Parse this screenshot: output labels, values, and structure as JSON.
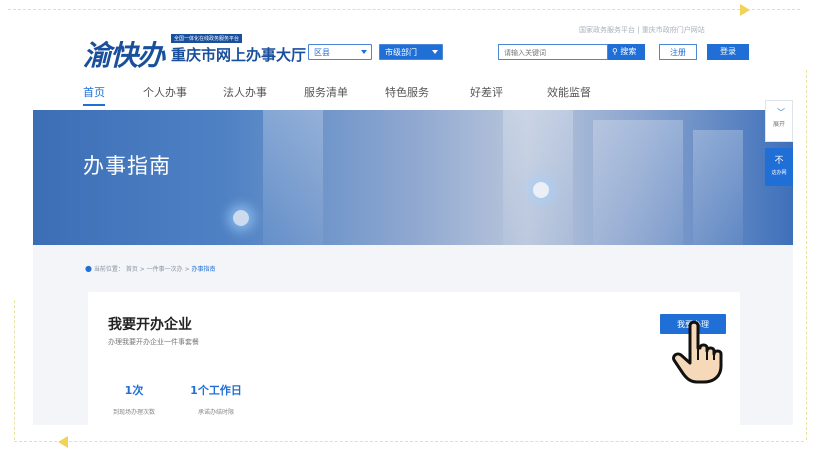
{
  "header": {
    "logo_script": "渝快办",
    "logo_tag": "全国一体化在线政务服务平台",
    "logo_name": "重庆市网上办事大厅",
    "district_select": "区县",
    "dept_select": "市级部门",
    "top_links": "国家政务服务平台 | 重庆市政府门户网站",
    "search_placeholder": "请输入关键词",
    "search_button": "搜索",
    "register": "注册",
    "login": "登录"
  },
  "nav": {
    "items": [
      {
        "label": "首页"
      },
      {
        "label": "个人办事"
      },
      {
        "label": "法人办事"
      },
      {
        "label": "服务清单"
      },
      {
        "label": "特色服务"
      },
      {
        "label": "好差评"
      },
      {
        "label": "效能监督"
      }
    ]
  },
  "banner": {
    "title": "办事指南"
  },
  "side": {
    "top_label": "展开",
    "bottom_label": "不",
    "bottom_sub": "这办网"
  },
  "breadcrumb": {
    "text": "当前位置： 首页 > 一件事一次办 > ",
    "current": "办事指南"
  },
  "card": {
    "title": "我要开办企业",
    "subtitle": "办理我要开办企业一件事套餐",
    "stats": [
      {
        "value": "1次",
        "label": "到现场办理次数"
      },
      {
        "value": "1个工作日",
        "label": "承诺办结时限"
      }
    ],
    "apply_button": "我要办理"
  },
  "colors": {
    "primary": "#1f6fd6",
    "brand": "#1a4f9c"
  },
  "icons": {
    "location": "location-pin-icon",
    "search": "search-icon",
    "cursor": "hand-pointer-icon"
  }
}
